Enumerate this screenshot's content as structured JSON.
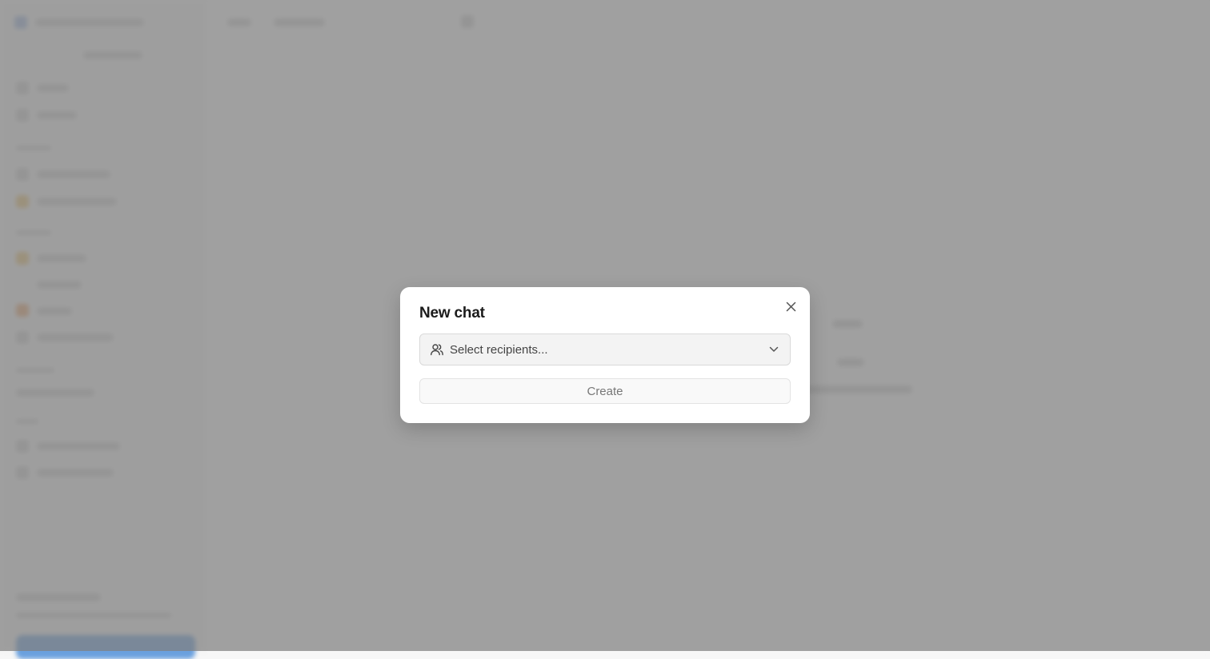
{
  "dialog": {
    "title": "New chat",
    "close_icon": "close-icon",
    "recipients": {
      "placeholder": "Select recipients...",
      "leading_icon": "users-icon",
      "trailing_icon": "chevron-down-icon"
    },
    "create_label": "Create"
  },
  "colors": {
    "overlay": "#808080",
    "dialog_bg": "#ffffff",
    "select_bg": "#f3f3f3"
  }
}
